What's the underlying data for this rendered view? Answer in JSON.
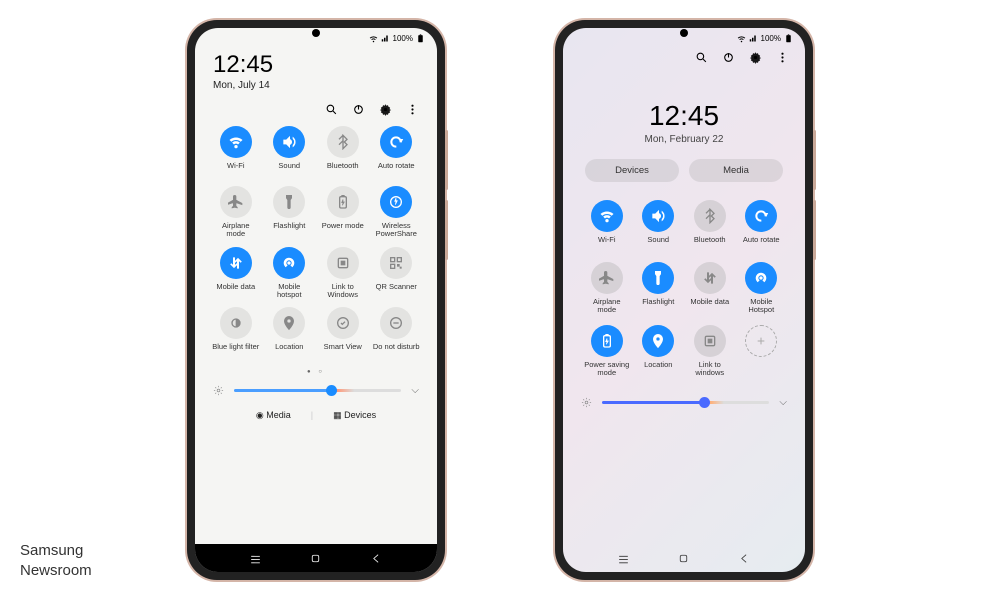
{
  "watermark": {
    "line1": "Samsung",
    "line2": "Newsroom"
  },
  "status": {
    "battery": "100%"
  },
  "left": {
    "time": "12:45",
    "date": "Mon, July 14",
    "toolbar": [
      "search",
      "power",
      "settings",
      "more"
    ],
    "tiles": [
      {
        "label": "Wi-Fi",
        "on": true,
        "icon": "wifi"
      },
      {
        "label": "Sound",
        "on": true,
        "icon": "sound"
      },
      {
        "label": "Bluetooth",
        "on": false,
        "icon": "bluetooth"
      },
      {
        "label": "Auto rotate",
        "on": true,
        "icon": "rotate"
      },
      {
        "label": "Airplane mode",
        "on": false,
        "icon": "airplane"
      },
      {
        "label": "Flashlight",
        "on": false,
        "icon": "flashlight"
      },
      {
        "label": "Power mode",
        "on": false,
        "icon": "powermode"
      },
      {
        "label": "Wireless PowerShare",
        "on": true,
        "icon": "powershare"
      },
      {
        "label": "Mobile data",
        "on": true,
        "icon": "mobiledata"
      },
      {
        "label": "Mobile hotspot",
        "on": true,
        "icon": "hotspot"
      },
      {
        "label": "Link to Windows",
        "on": false,
        "icon": "link"
      },
      {
        "label": "QR Scanner",
        "on": false,
        "icon": "qr"
      },
      {
        "label": "Blue light filter",
        "on": false,
        "icon": "bluelight"
      },
      {
        "label": "Location",
        "on": false,
        "icon": "location"
      },
      {
        "label": "Smart View",
        "on": false,
        "icon": "smartview"
      },
      {
        "label": "Do not disturb",
        "on": false,
        "icon": "dnd"
      }
    ],
    "bottom": {
      "media": "Media",
      "devices": "Devices"
    }
  },
  "right": {
    "time": "12:45",
    "date": "Mon, February 22",
    "toolbar": [
      "search",
      "power",
      "settings",
      "more"
    ],
    "pills": [
      "Devices",
      "Media"
    ],
    "tiles": [
      {
        "label": "Wi-Fi",
        "on": true,
        "icon": "wifi"
      },
      {
        "label": "Sound",
        "on": true,
        "icon": "sound"
      },
      {
        "label": "Bluetooth",
        "on": false,
        "icon": "bluetooth"
      },
      {
        "label": "Auto rotate",
        "on": true,
        "icon": "rotate"
      },
      {
        "label": "Airplane mode",
        "on": false,
        "icon": "airplane"
      },
      {
        "label": "Flashlight",
        "on": true,
        "icon": "flashlight"
      },
      {
        "label": "Mobile data",
        "on": false,
        "icon": "mobiledata"
      },
      {
        "label": "Mobile Hotspot",
        "on": true,
        "icon": "hotspot"
      },
      {
        "label": "Power saving mode",
        "on": true,
        "icon": "powermode"
      },
      {
        "label": "Location",
        "on": true,
        "icon": "location"
      },
      {
        "label": "Link to windows",
        "on": false,
        "icon": "link"
      },
      {
        "label": "",
        "on": false,
        "icon": "add"
      }
    ]
  }
}
